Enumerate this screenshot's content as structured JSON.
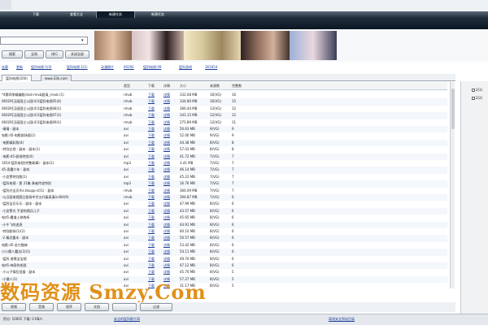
{
  "menu": {
    "tabs": [
      {
        "label": "下载"
      },
      {
        "label": "查看大全"
      },
      {
        "label": "新建任务"
      },
      {
        "label": "新建任务"
      }
    ]
  },
  "search": {
    "value": "",
    "buttons": [
      "搜索",
      "全网",
      "排行",
      "关闭全部"
    ]
  },
  "links": [
    "连载",
    "更新",
    "猛犸电视:1(0)",
    "猛犸电视:1(1)",
    "动漫图片",
    "00292",
    "猛犸电视:09",
    "猛犸游戏",
    "361654"
  ],
  "tabs": [
    "猛犸电视(200)",
    "www.33k.com"
  ],
  "table": {
    "headers": {
      "type": "类型",
      "dl": "下载",
      "det": "详情",
      "size": "大小",
      "src": "来源数",
      "cnt": "完整数"
    },
    "rows": [
      {
        "name": "*4第四季精编版(dvd-rmvb超清_rmvb (1)",
        "type": "rmvb",
        "dl": "下载",
        "det": "详情",
        "size": "332.08 MB",
        "src": "16(VG)",
        "cnt": "16"
      },
      {
        "name": "06029]汉画国立公园(4)1猛犸电视05(4)",
        "type": "rmvb",
        "dl": "下载",
        "det": "详情",
        "size": "334.80 MB",
        "src": "16(VG)",
        "cnt": "15"
      },
      {
        "name": "06029]汉画国立公园(4)1猛犸电视08(1)",
        "type": "rmvb",
        "dl": "下载",
        "det": "详情",
        "size": "366.44 MB",
        "src": "13(VG)",
        "cnt": "12"
      },
      {
        "name": "06029]汉画国立公园(4)1猛犸电视07(1)",
        "type": "rmvb",
        "dl": "下载",
        "det": "详情",
        "size": "341.15 MB",
        "src": "12(VG)",
        "cnt": "12"
      },
      {
        "name": "06029]汉画国立公园(4)1猛犸电视09(1)",
        "type": "rmvb",
        "dl": "下载",
        "det": "详情",
        "size": "275.89 MB",
        "src": "12(VG)",
        "cnt": "11"
      },
      {
        "name": "-倩倩 - 副本",
        "type": "avi",
        "dl": "下载",
        "det": "详情",
        "size": "50.63 MB",
        "src": "9(VG)",
        "cnt": "9"
      },
      {
        "name": "电影:d5-电影剧场版(2)",
        "type": "avi",
        "dl": "下载",
        "det": "详情",
        "size": "52.00 MB",
        "src": "9(VG)",
        "cnt": "9"
      },
      {
        "name": "-电影精彩版(4)",
        "type": "avi",
        "dl": "下载",
        "det": "详情",
        "size": "44.38 MB",
        "src": "8(VG)",
        "cnt": "8"
      },
      {
        "name": "-特别企划 - 副本 - 副本(1)",
        "type": "avi",
        "dl": "下载",
        "det": "详情",
        "size": "57.03 MB",
        "src": "8(VG)",
        "cnt": "8"
      },
      {
        "name": "-电影:d5-剧场特别(4)",
        "type": "avi",
        "dl": "下载",
        "det": "详情",
        "size": "41.72 MB",
        "src": "7(VG)",
        "cnt": "7"
      },
      {
        "name": "1654-猛犸电视(完整故事) - 副本(1)",
        "type": "mp3",
        "dl": "下载",
        "det": "详情",
        "size": "3.41 MB",
        "src": "7(VG)",
        "cnt": "7"
      },
      {
        "name": "d5-恶魔少年 - 副本",
        "type": "avi",
        "dl": "下载",
        "det": "详情",
        "size": "46.14 MB",
        "src": "7(VG)",
        "cnt": "7"
      },
      {
        "name": "-小女警特别版(1)",
        "type": "avi",
        "dl": "下载",
        "det": "详情",
        "size": "45.22 MB",
        "src": "7(VG)",
        "cnt": "7"
      },
      {
        "name": "-猛犸电视 - 第 21集 勇者传说特别",
        "type": "mp3",
        "dl": "下载",
        "det": "详情",
        "size": "16.76 MB",
        "src": "7(VG)",
        "cnt": "7"
      },
      {
        "name": "-猛犸光宝贝(hs.hbupp-ct(1) - 副本",
        "type": "rmvb",
        "dl": "下载",
        "det": "详情",
        "size": "366.09 MB",
        "src": "7(VG)",
        "cnt": "7"
      },
      {
        "name": "-ry汉画电视国立剧场中字五升级高清(cd04(9)",
        "type": "rmvb",
        "dl": "下载",
        "det": "详情",
        "size": "394.87 MB",
        "src": "7(VG)",
        "cnt": "6"
      },
      {
        "name": "-猛犸宝贝乐乐 - 副本 - 副本",
        "type": "avi",
        "dl": "下载",
        "det": "详情",
        "size": "47.99 MB",
        "src": "8(VG)",
        "cnt": "6"
      },
      {
        "name": "-小女警光 手游的佣兵儿子",
        "type": "avi",
        "dl": "下载",
        "det": "详情",
        "size": "43.57 MB",
        "src": "8(VG)",
        "cnt": "6"
      },
      {
        "name": "电d5-魔道士修练所",
        "type": "avi",
        "dl": "下载",
        "det": "详情",
        "size": "45.65 MB",
        "src": "8(VG)",
        "cnt": "6"
      },
      {
        "name": "-小午飞的追逐",
        "type": "avi",
        "dl": "下载",
        "det": "详情",
        "size": "44.91 MB",
        "src": "8(VG)",
        "cnt": "6"
      },
      {
        "name": "-特别剧场(1)(2)",
        "type": "avi",
        "dl": "下载",
        "det": "详情",
        "size": "60.10 MB",
        "src": "8(VG)",
        "cnt": "6"
      },
      {
        "name": "-2 精灵重本 - 副本",
        "type": "avi",
        "dl": "下载",
        "det": "详情",
        "size": "50.57 MB",
        "src": "8(VG)",
        "cnt": "6"
      },
      {
        "name": "电影:d5-金刃猫神",
        "type": "avi",
        "dl": "下载",
        "det": "详情",
        "size": "53.42 MB",
        "src": "8(VG)",
        "cnt": "6"
      },
      {
        "name": "小小僵人魔法(3)(1)",
        "type": "avi",
        "dl": "下载",
        "det": "详情",
        "size": "54.11 MB",
        "src": "8(VG)",
        "cnt": "6"
      },
      {
        "name": "-猛犸 香蕉宝宝规",
        "type": "avi",
        "dl": "下载",
        "det": "详情",
        "size": "49.70 MB",
        "src": "8(VG)",
        "cnt": "6"
      },
      {
        "name": "电d5-神奇的毛毯",
        "type": "avi",
        "dl": "下载",
        "det": "详情",
        "size": "47.12 MB",
        "src": "8(VG)",
        "cnt": "6"
      },
      {
        "name": "-小公子搞乱怪蛋 - 副本",
        "type": "avi",
        "dl": "下载",
        "det": "详情",
        "size": "45.70 MB",
        "src": "8(VG)",
        "cnt": "5"
      },
      {
        "name": "-小僵人(1)",
        "type": "avi",
        "dl": "下载",
        "det": "详情",
        "size": "57.27 MB",
        "src": "8(VG)",
        "cnt": "5"
      },
      {
        "name": "",
        "type": "avi",
        "dl": "下载",
        "det": "详情",
        "size": "31.17 MB",
        "src": "8(VG)",
        "cnt": "5"
      }
    ]
  },
  "right_panel": {
    "items": [
      "2(1)",
      "2(2)"
    ]
  },
  "watermark": "数码资源 Smzy.Com",
  "bottom_buttons": [
    "视频",
    "音频",
    "程序",
    "文档",
    "",
    "过滤"
  ],
  "status": {
    "left": "积分: 10001  下载: 0 KB/s",
    "link1": "安全的猛犸影片网",
    "link2": "离线安全到站目录"
  },
  "colors": {
    "title_bar": "#1f2d3b",
    "link": "#1a3c9a",
    "watermark": "#e0901a"
  }
}
